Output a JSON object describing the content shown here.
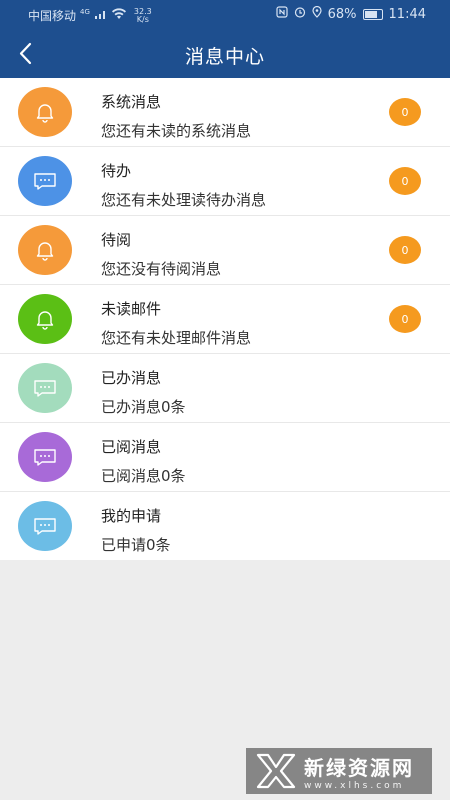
{
  "status_bar": {
    "carrier": "中国移动",
    "network": "4G",
    "speed_value": "32.3",
    "speed_unit": "K/s",
    "battery": "68%",
    "time": "11:44"
  },
  "header": {
    "title": "消息中心",
    "back_icon": "chevron-left-icon"
  },
  "messages": [
    {
      "title": "系统消息",
      "subtitle": "您还有未读的系统消息",
      "icon": "bell-icon",
      "color": "#f59a3a",
      "badge": "0"
    },
    {
      "title": "待办",
      "subtitle": "您还有未处理读待办消息",
      "icon": "chat-icon",
      "color": "#4d92e6",
      "badge": "0"
    },
    {
      "title": "待阅",
      "subtitle": "您还没有待阅消息",
      "icon": "bell-icon",
      "color": "#f59a3a",
      "badge": "0"
    },
    {
      "title": "未读邮件",
      "subtitle": "您还有未处理邮件消息",
      "icon": "bell-icon",
      "color": "#5bbf15",
      "badge": "0"
    },
    {
      "title": "已办消息",
      "subtitle": "已办消息0条",
      "icon": "chat-icon",
      "color": "#a3dcbd",
      "badge": null
    },
    {
      "title": "已阅消息",
      "subtitle": "已阅消息0条",
      "icon": "chat-icon",
      "color": "#a86ad8",
      "badge": null
    },
    {
      "title": "我的申请",
      "subtitle": "已申请0条",
      "icon": "chat-icon",
      "color": "#6cbde6",
      "badge": null
    }
  ],
  "watermark": {
    "name": "新绿资源网",
    "url": "www.xlhs.com"
  }
}
